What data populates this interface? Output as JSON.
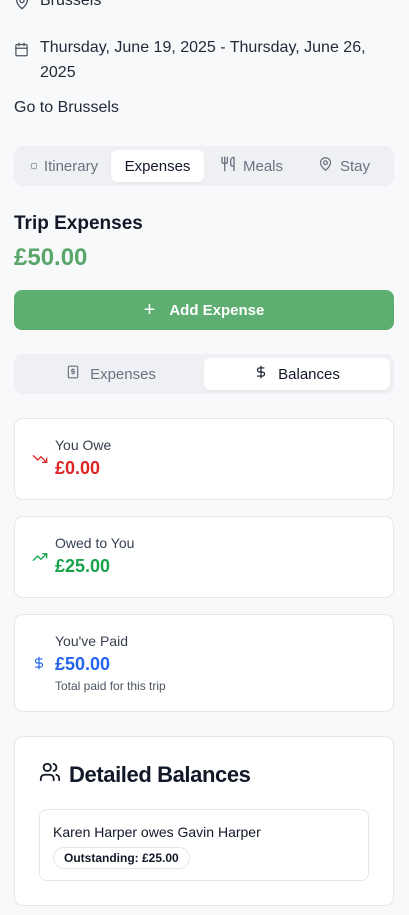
{
  "trip": {
    "location": "Brussels",
    "dates": "Thursday, June 19, 2025 - Thursday, June 26, 2025",
    "description": "Go to Brussels"
  },
  "tabs": [
    {
      "label": "Itinerary",
      "icon": "itinerary-icon",
      "active": false
    },
    {
      "label": "Expenses",
      "icon": "",
      "active": true
    },
    {
      "label": "Meals",
      "icon": "utensils-icon",
      "active": false
    },
    {
      "label": "Stay",
      "icon": "map-pin-icon",
      "active": false
    }
  ],
  "expenses": {
    "title": "Trip Expenses",
    "total": "£50.00",
    "add_button": "Add Expense"
  },
  "subtabs": [
    {
      "label": "Expenses",
      "icon": "receipt-icon",
      "active": false
    },
    {
      "label": "Balances",
      "icon": "dollar-icon",
      "active": true
    }
  ],
  "stats": {
    "you_owe": {
      "label": "You Owe",
      "value": "£0.00",
      "icon": "trending-down-icon"
    },
    "owed_to_you": {
      "label": "Owed to You",
      "value": "£25.00",
      "icon": "trending-up-icon"
    },
    "you_paid": {
      "label": "You've Paid",
      "value": "£50.00",
      "note": "Total paid for this trip",
      "icon": "dollar-icon"
    }
  },
  "detailed": {
    "title": "Detailed Balances",
    "items": [
      {
        "text": "Karen Harper owes Gavin Harper",
        "badge": "Outstanding: £25.00"
      }
    ]
  },
  "colors": {
    "primary_green": "#5eae71",
    "total_green": "#5aa66a",
    "owe_red": "#dc2626",
    "owed_green": "#16a34a",
    "paid_blue": "#2563eb"
  }
}
